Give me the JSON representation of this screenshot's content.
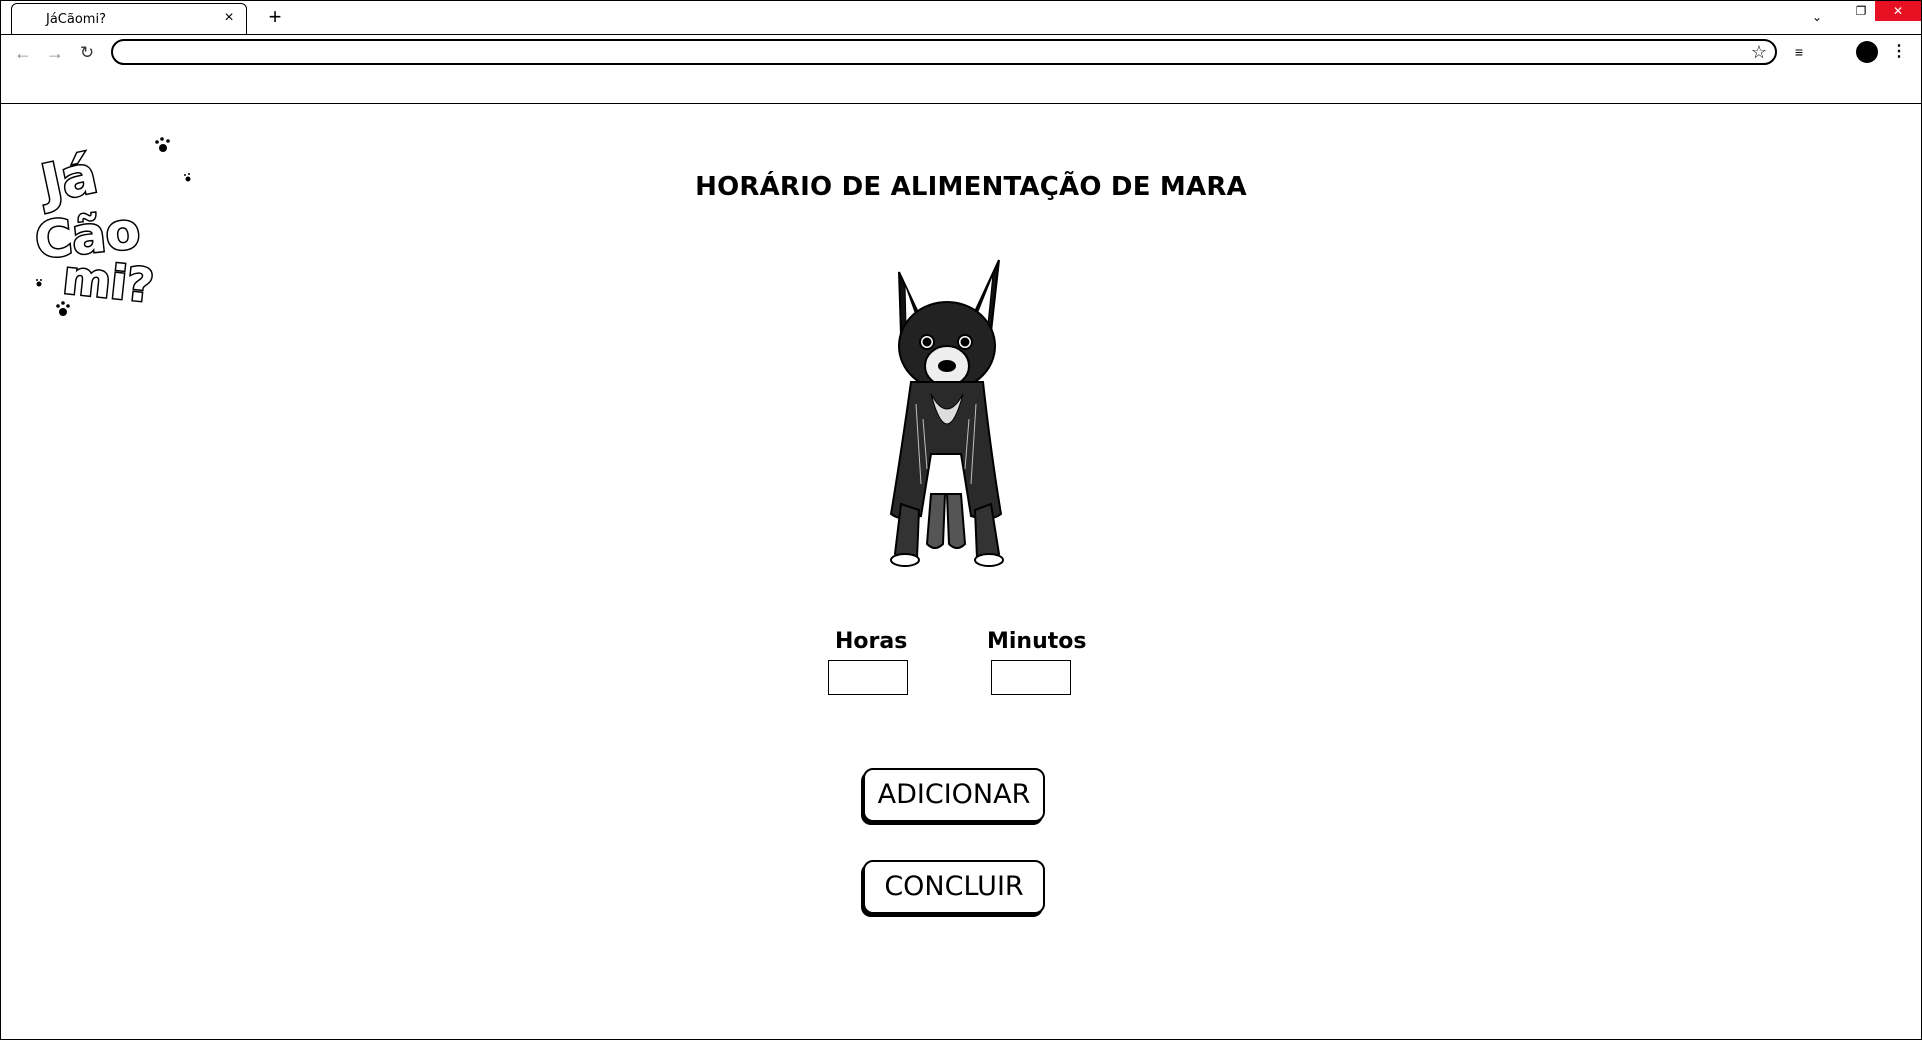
{
  "browser": {
    "tab_title": "JáCãomi?",
    "tab_close_icon": "×",
    "new_tab_icon": "+",
    "omnibox_value": "",
    "omnibox_placeholder": "",
    "icons": {
      "back": "←",
      "forward": "→",
      "reload": "↻",
      "star": "☆",
      "reading_list": "≡",
      "menu": "⋮",
      "tab_search": "⌄",
      "restore": "❐",
      "close": "✕"
    }
  },
  "page": {
    "title": "HORÁRIO DE ALIMENTAÇÃO DE MARA",
    "hours_label": "Horas",
    "minutes_label": "Minutos",
    "hours_value": "",
    "minutes_value": "",
    "add_button": "ADICIONAR",
    "finish_button": "CONCLUIR",
    "logo_text": "Já Cão mi?"
  }
}
